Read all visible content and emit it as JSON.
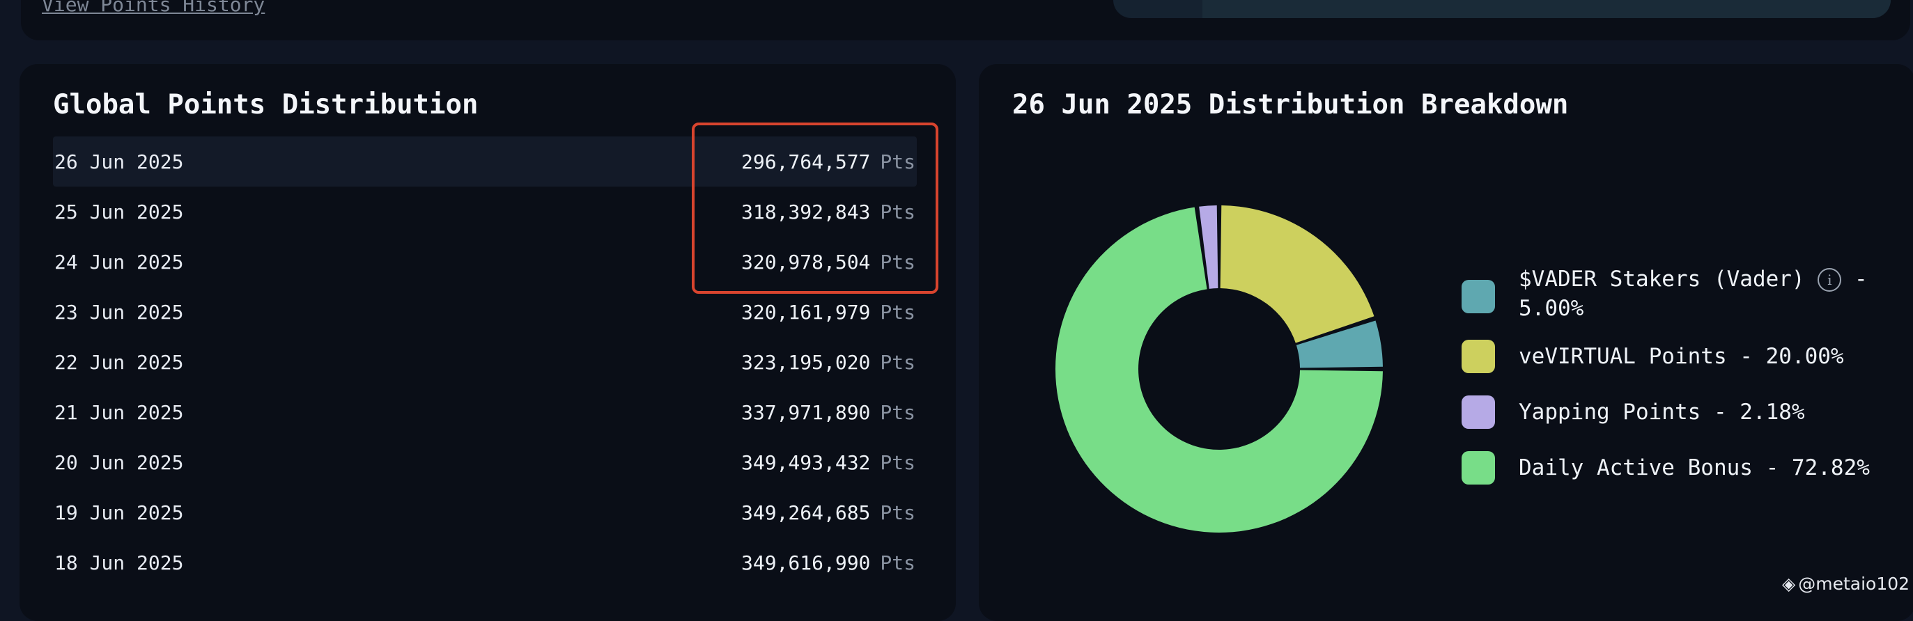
{
  "header": {
    "history_link": "View Points History"
  },
  "distribution": {
    "title": "Global Points Distribution",
    "unit": "Pts",
    "rows": [
      {
        "date": "26 Jun 2025",
        "value": "296,764,577"
      },
      {
        "date": "25 Jun 2025",
        "value": "318,392,843"
      },
      {
        "date": "24 Jun 2025",
        "value": "320,978,504"
      },
      {
        "date": "23 Jun 2025",
        "value": "320,161,979"
      },
      {
        "date": "22 Jun 2025",
        "value": "323,195,020"
      },
      {
        "date": "21 Jun 2025",
        "value": "337,971,890"
      },
      {
        "date": "20 Jun 2025",
        "value": "349,493,432"
      },
      {
        "date": "19 Jun 2025",
        "value": "349,264,685"
      },
      {
        "date": "18 Jun 2025",
        "value": "349,616,990"
      }
    ]
  },
  "breakdown": {
    "title": "26 Jun 2025 Distribution Breakdown",
    "legend": [
      {
        "label_line1": "$VADER Stakers (Vader)",
        "label_suffix": "-",
        "label_line2": "5.00%",
        "color": "#5fa8b0",
        "percent": 5.0
      },
      {
        "label": "veVIRTUAL Points - 20.00%",
        "color": "#cdd05e",
        "percent": 20.0
      },
      {
        "label": "Yapping Points - 2.18%",
        "color": "#b6aae6",
        "percent": 2.18
      },
      {
        "label": "Daily Active Bonus - 72.82%",
        "color": "#78dd88",
        "percent": 72.82
      }
    ],
    "info_icon": "i"
  },
  "watermark": {
    "logo_icon": "binance-diamond-icon",
    "text": "@metaio102"
  }
}
